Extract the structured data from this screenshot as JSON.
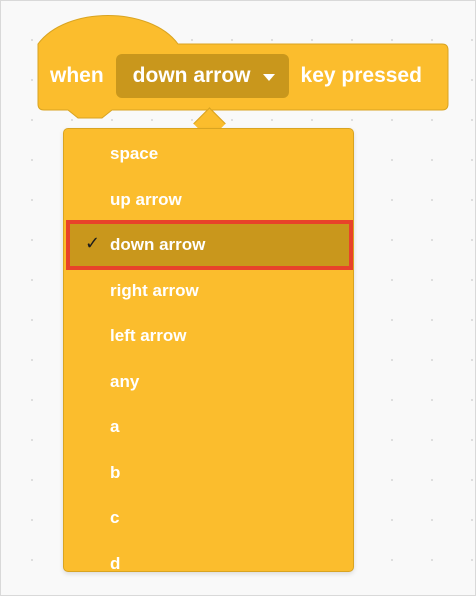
{
  "block": {
    "prefix": "when",
    "selected_key": "down arrow",
    "suffix": "key pressed"
  },
  "menu": {
    "items": [
      {
        "label": "space",
        "selected": false
      },
      {
        "label": "up arrow",
        "selected": false
      },
      {
        "label": "down arrow",
        "selected": true
      },
      {
        "label": "right arrow",
        "selected": false
      },
      {
        "label": "left arrow",
        "selected": false
      },
      {
        "label": "any",
        "selected": false
      },
      {
        "label": "a",
        "selected": false
      },
      {
        "label": "b",
        "selected": false
      },
      {
        "label": "c",
        "selected": false
      },
      {
        "label": "d",
        "selected": false
      }
    ],
    "check_glyph": "✓"
  },
  "colors": {
    "block_fill": "#fbbd2d",
    "block_outline": "#d9a421",
    "dropdown_fill": "#c9971c",
    "highlight_outline": "#e8422a",
    "text": "#ffffff"
  },
  "icons": {
    "caret": "caret-down-icon",
    "check": "check-icon"
  }
}
